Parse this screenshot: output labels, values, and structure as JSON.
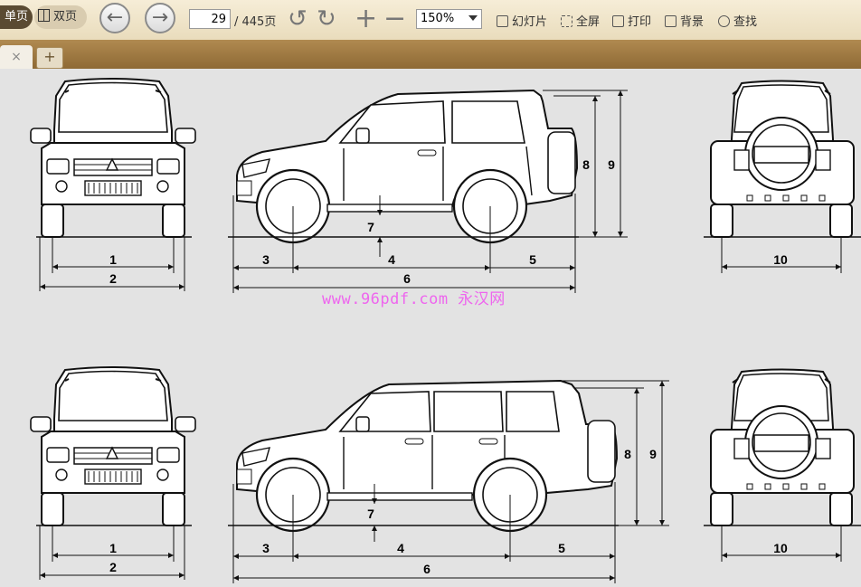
{
  "toolbar": {
    "single_page": "单页",
    "double_page": "双页",
    "current_page": "29",
    "total_pages": "/ 445页",
    "zoom": "150%",
    "slideshow": "幻灯片",
    "fullscreen": "全屏",
    "print": "打印",
    "background": "背景",
    "find": "查找"
  },
  "tabs": {
    "close": "×",
    "add": "+"
  },
  "document": {
    "watermark": "www.96pdf.com 永汉网",
    "diagram_top": {
      "labels": [
        "1",
        "2",
        "3",
        "4",
        "5",
        "6",
        "7",
        "8",
        "9",
        "10"
      ]
    },
    "diagram_bottom": {
      "labels": [
        "1",
        "2",
        "3",
        "4",
        "5",
        "6",
        "7",
        "8",
        "9",
        "10"
      ]
    }
  }
}
